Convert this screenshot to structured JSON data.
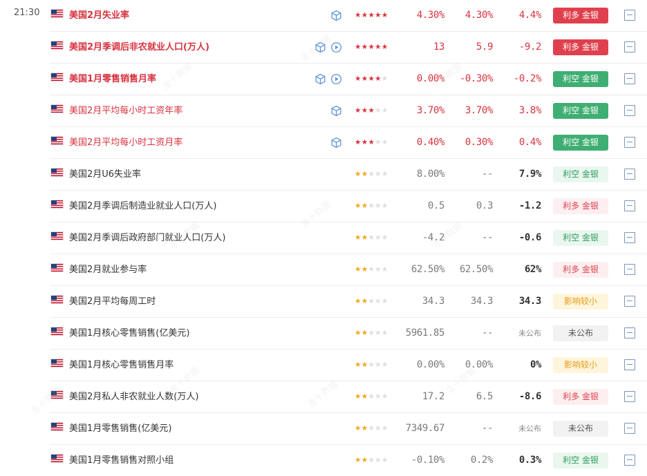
{
  "time": "21:30",
  "watermark": "金十数据",
  "rows": [
    {
      "name": "美国2月失业率",
      "stars": 5,
      "star_color": "red",
      "prev": "4.30%",
      "fore": "4.30%",
      "act": "4.4%",
      "badge": "利多 金银",
      "badge_style": "bull-strong",
      "highlight": true,
      "bold": true,
      "icons": [
        "cube"
      ]
    },
    {
      "name": "美国2月季调后非农就业人口(万人)",
      "stars": 5,
      "star_color": "red",
      "prev": "13",
      "fore": "5.9",
      "act": "-9.2",
      "badge": "利多 金银",
      "badge_style": "bull-strong",
      "highlight": true,
      "bold": true,
      "icons": [
        "cube",
        "play"
      ]
    },
    {
      "name": "美国1月零售销售月率",
      "stars": 4,
      "star_color": "red",
      "prev": "0.00%",
      "fore": "-0.30%",
      "act": "-0.2%",
      "badge": "利空 金银",
      "badge_style": "bear-strong",
      "highlight": true,
      "bold": true,
      "icons": [
        "cube",
        "play"
      ]
    },
    {
      "name": "美国2月平均每小时工资年率",
      "stars": 3,
      "star_color": "red",
      "prev": "3.70%",
      "fore": "3.70%",
      "act": "3.8%",
      "badge": "利空 金银",
      "badge_style": "bear-strong",
      "highlight": true,
      "bold": false,
      "icons": [
        "cube"
      ]
    },
    {
      "name": "美国2月平均每小时工资月率",
      "stars": 3,
      "star_color": "red",
      "prev": "0.40%",
      "fore": "0.30%",
      "act": "0.4%",
      "badge": "利空 金银",
      "badge_style": "bear-strong",
      "highlight": true,
      "bold": false,
      "icons": [
        "cube"
      ]
    },
    {
      "name": "美国2月U6失业率",
      "stars": 2,
      "star_color": "gold",
      "prev": "8.00%",
      "fore": "--",
      "act": "7.9%",
      "badge": "利空 金银",
      "badge_style": "bear-light",
      "highlight": false,
      "bold": false,
      "icons": []
    },
    {
      "name": "美国2月季调后制造业就业人口(万人)",
      "stars": 2,
      "star_color": "gold",
      "prev": "0.5",
      "fore": "0.3",
      "act": "-1.2",
      "badge": "利多 金银",
      "badge_style": "bull-light",
      "highlight": false,
      "bold": false,
      "icons": []
    },
    {
      "name": "美国2月季调后政府部门就业人口(万人)",
      "stars": 2,
      "star_color": "gold",
      "prev": "-4.2",
      "fore": "--",
      "act": "-0.6",
      "badge": "利空 金银",
      "badge_style": "bear-light",
      "highlight": false,
      "bold": false,
      "icons": []
    },
    {
      "name": "美国2月就业参与率",
      "stars": 2,
      "star_color": "gold",
      "prev": "62.50%",
      "fore": "62.50%",
      "act": "62%",
      "badge": "利多 金银",
      "badge_style": "bull-light",
      "highlight": false,
      "bold": false,
      "icons": []
    },
    {
      "name": "美国2月平均每周工时",
      "stars": 2,
      "star_color": "gold",
      "prev": "34.3",
      "fore": "34.3",
      "act": "34.3",
      "badge": "影响较小",
      "badge_style": "minor",
      "highlight": false,
      "bold": false,
      "icons": []
    },
    {
      "name": "美国1月核心零售销售(亿美元)",
      "stars": 2,
      "star_color": "gold",
      "prev": "5961.85",
      "fore": "--",
      "act": "未公布",
      "badge": "未公布",
      "badge_style": "pending",
      "highlight": false,
      "bold": false,
      "icons": [],
      "pending": true
    },
    {
      "name": "美国1月核心零售销售月率",
      "stars": 2,
      "star_color": "gold",
      "prev": "0.00%",
      "fore": "0.00%",
      "act": "0%",
      "badge": "影响较小",
      "badge_style": "minor",
      "highlight": false,
      "bold": false,
      "icons": []
    },
    {
      "name": "美国2月私人非农就业人数(万人)",
      "stars": 2,
      "star_color": "gold",
      "prev": "17.2",
      "fore": "6.5",
      "act": "-8.6",
      "badge": "利多 金银",
      "badge_style": "bull-light",
      "highlight": false,
      "bold": false,
      "icons": []
    },
    {
      "name": "美国1月零售销售(亿美元)",
      "stars": 2,
      "star_color": "gold",
      "prev": "7349.67",
      "fore": "--",
      "act": "未公布",
      "badge": "未公布",
      "badge_style": "pending",
      "highlight": false,
      "bold": false,
      "icons": [],
      "pending": true
    },
    {
      "name": "美国1月零售销售对照小组",
      "stars": 2,
      "star_color": "gold",
      "prev": "-0.10%",
      "fore": "0.2%",
      "act": "0.3%",
      "badge": "利空 金银",
      "badge_style": "bear-light",
      "highlight": false,
      "bold": false,
      "icons": []
    }
  ]
}
